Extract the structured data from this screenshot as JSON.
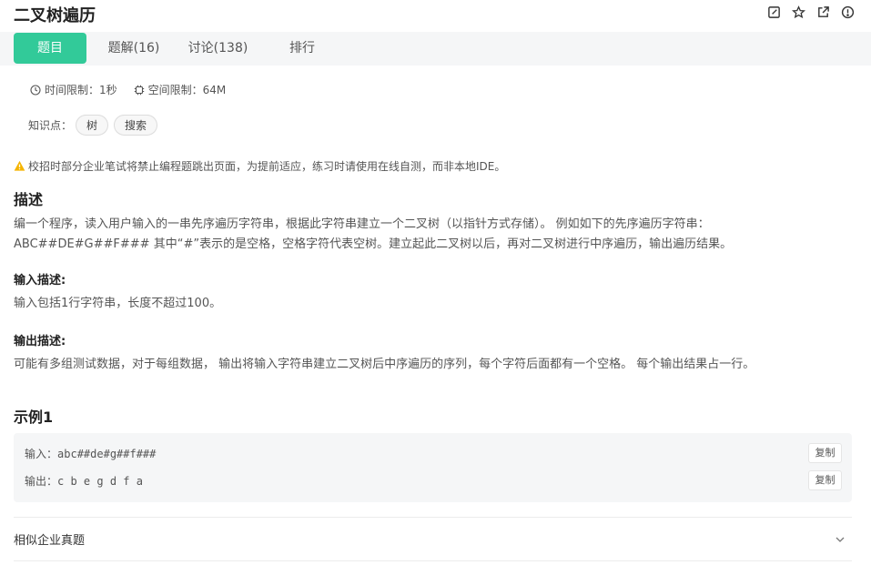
{
  "header": {
    "title": "二叉树遍历",
    "icons": [
      "edit-icon",
      "star-icon",
      "external-link-icon",
      "info-icon"
    ]
  },
  "tabs": [
    {
      "label": "题目",
      "active": true
    },
    {
      "label": "题解(16)",
      "active": false
    },
    {
      "label": "讨论(138)",
      "active": false
    },
    {
      "label": "排行",
      "active": false
    }
  ],
  "limits": {
    "time": "时间限制：1秒",
    "space": "空间限制：64M"
  },
  "knowledge": {
    "label": "知识点：",
    "tags": [
      "树",
      "搜索"
    ]
  },
  "warning": "校招时部分企业笔试将禁止编程题跳出页面，为提前适应，练习时请使用在线自测，而非本地IDE。",
  "description": {
    "heading": "描述",
    "line1": "编一个程序，读入用户输入的一串先序遍历字符串，根据此字符串建立一个二叉树（以指针方式存储）。 例如如下的先序遍历字符串：",
    "line2": "ABC##DE#G##F### 其中“#”表示的是空格，空格字符代表空树。建立起此二叉树以后，再对二叉树进行中序遍历，输出遍历结果。"
  },
  "input_desc": {
    "heading": "输入描述:",
    "text": "输入包括1行字符串，长度不超过100。"
  },
  "output_desc": {
    "heading": "输出描述:",
    "text": "可能有多组测试数据，对于每组数据， 输出将输入字符串建立二叉树后中序遍历的序列，每个字符后面都有一个空格。 每个输出结果占一行。"
  },
  "example": {
    "heading": "示例1",
    "input_label": "输入：",
    "input_value": "abc##de#g##f###",
    "output_label": "输出：",
    "output_value": "c b e g d f a",
    "copy_label": "复制"
  },
  "similar": {
    "label": "相似企业真题"
  },
  "colors": {
    "accent": "#32ca99",
    "warning": "#f5b400"
  }
}
